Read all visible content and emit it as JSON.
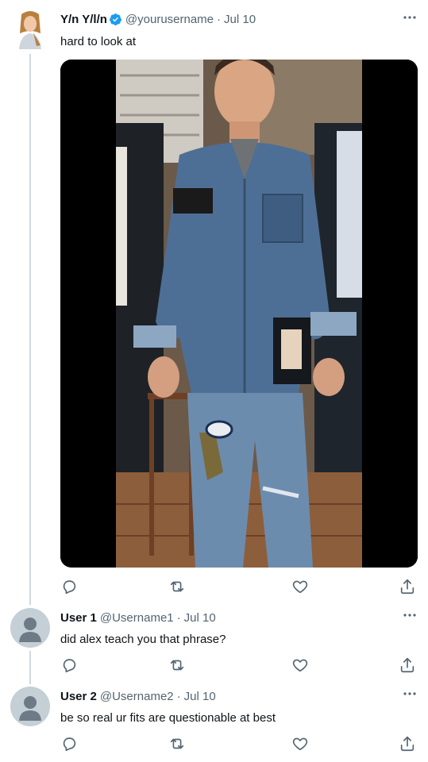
{
  "tweet": {
    "display_name": "Y/n Y/l/n",
    "handle": "@yourusername",
    "date": "Jul 10",
    "text": "hard to look at",
    "verified": true,
    "media_alt": "photo"
  },
  "replies": [
    {
      "display_name": "User 1",
      "handle": "@Username1",
      "date": "Jul 10",
      "text": "did alex teach you that phrase?"
    },
    {
      "display_name": "User 2",
      "handle": "@Username2",
      "date": "Jul 10",
      "text": "be so real ur fits are questionable at best"
    }
  ],
  "icons": {
    "reply": "reply-icon",
    "retweet": "retweet-icon",
    "like": "heart-icon",
    "share": "share-icon",
    "more": "more-icon",
    "verified": "verified-badge-icon"
  },
  "colors": {
    "text": "#0f1419",
    "muted": "#536471",
    "verified": "#1d9bf0",
    "thread_line": "#cfd9de",
    "avatar_placeholder": "#c4cfd6"
  }
}
